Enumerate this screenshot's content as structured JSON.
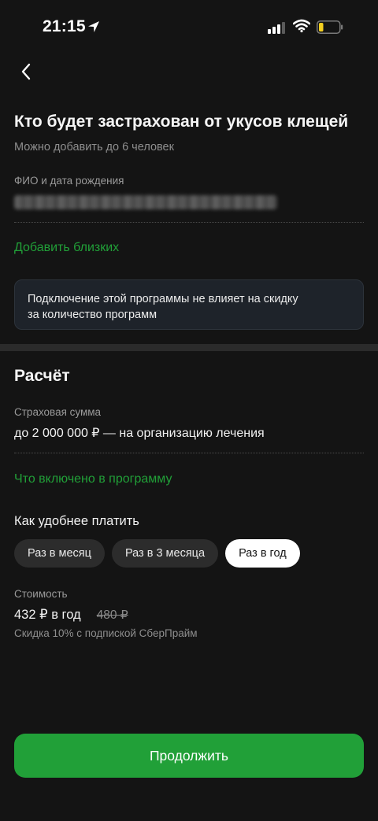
{
  "status_bar": {
    "time": "21:15"
  },
  "insured": {
    "title": "Кто будет застрахован от укусов клещей",
    "subtitle": "Можно добавить до 6 человек",
    "field_label": "ФИО и дата рождения",
    "add_relatives_link": "Добавить близких",
    "notice_line1": "Подключение этой программы не влияет на скидку",
    "notice_line2": "за количество программ"
  },
  "calculation": {
    "title": "Расчёт",
    "sum_label": "Страховая сумма",
    "sum_value": "до 2 000 000 ₽ — на организацию лечения",
    "included_link": "Что включено в программу",
    "payment_title": "Как удобнее платить",
    "payment_options": [
      {
        "label": "Раз в месяц",
        "selected": false
      },
      {
        "label": "Раз в 3 месяца",
        "selected": false
      },
      {
        "label": "Раз в год",
        "selected": true
      }
    ],
    "cost_label": "Стоимость",
    "price": "432 ₽ в год",
    "old_price": "480 ₽",
    "discount_note": "Скидка 10% с подпиской СберПрайм"
  },
  "cta": {
    "continue_label": "Продолжить"
  },
  "icons": {
    "back": "chevron-left-icon",
    "location": "location-arrow-icon",
    "signal": "cellular-signal-icon",
    "wifi": "wifi-icon",
    "battery": "battery-low-icon"
  },
  "colors": {
    "background": "#141414",
    "accent_green": "#21a038",
    "battery_level": "#f5d020"
  }
}
